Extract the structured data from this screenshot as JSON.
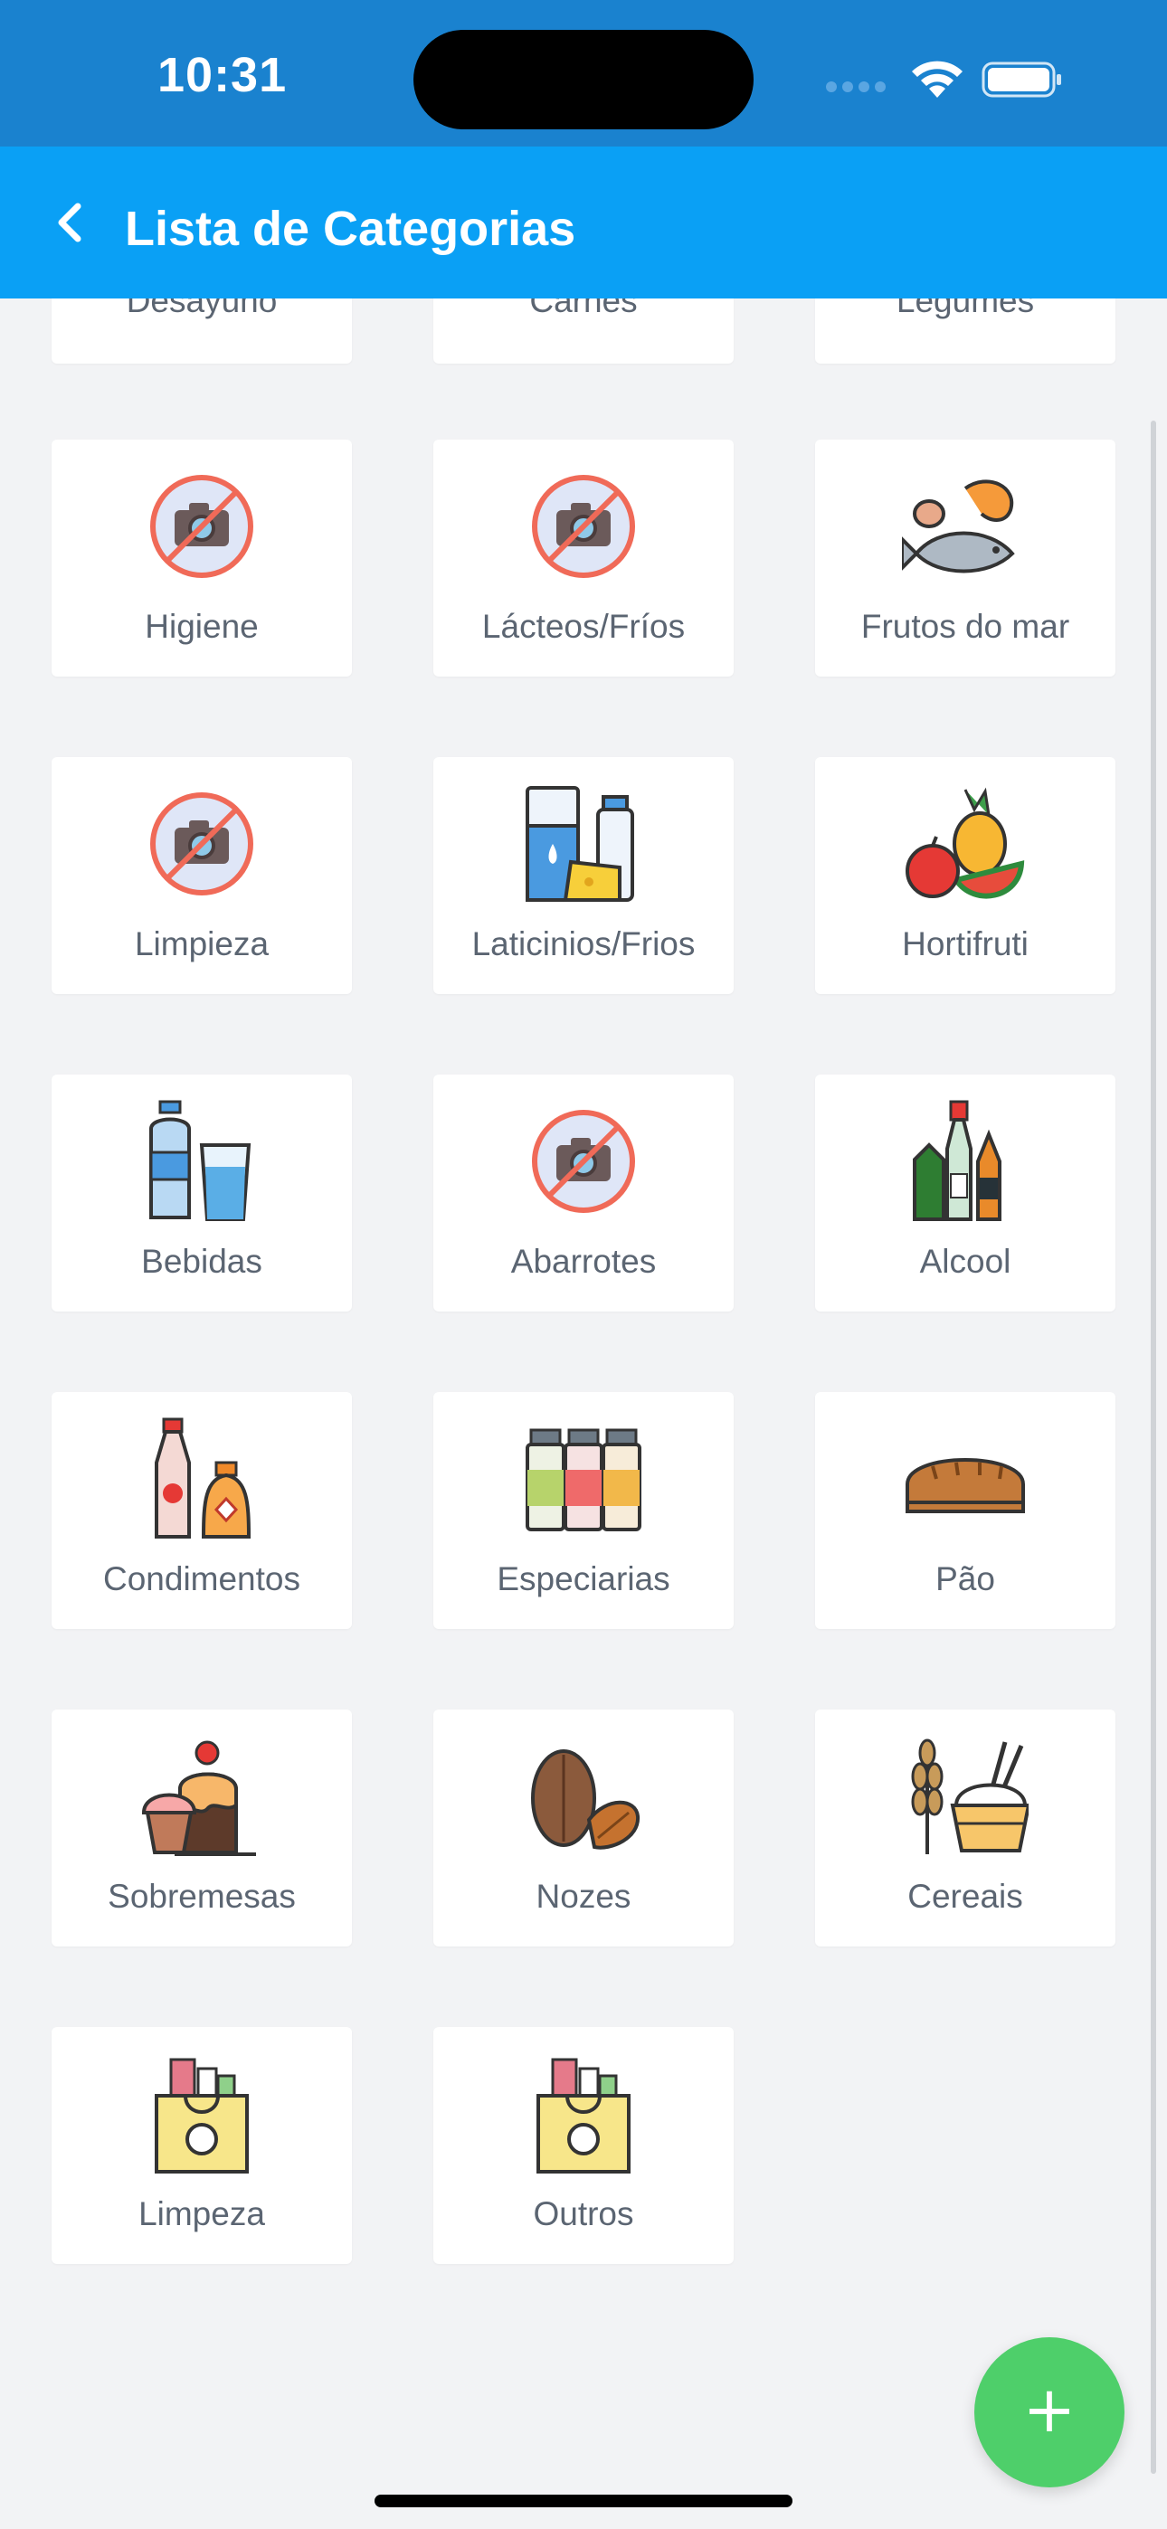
{
  "status_bar": {
    "time": "10:31"
  },
  "header": {
    "title": "Lista de Categorias",
    "background": "#0aa0f5"
  },
  "partial_row": [
    {
      "label": "Desayuno"
    },
    {
      "label": "Carnes"
    },
    {
      "label": "Legumes"
    }
  ],
  "categories": [
    {
      "label": "Higiene",
      "icon": "no-photo-icon"
    },
    {
      "label": "Lácteos/Fríos",
      "icon": "no-photo-icon"
    },
    {
      "label": "Frutos do mar",
      "icon": "seafood-icon"
    },
    {
      "label": "Limpieza",
      "icon": "no-photo-icon"
    },
    {
      "label": "Laticinios/Frios",
      "icon": "dairy-icon"
    },
    {
      "label": "Hortifruti",
      "icon": "fruits-icon"
    },
    {
      "label": "Bebidas",
      "icon": "water-bottle-icon"
    },
    {
      "label": "Abarrotes",
      "icon": "no-photo-icon"
    },
    {
      "label": "Alcool",
      "icon": "liquor-bottles-icon"
    },
    {
      "label": "Condimentos",
      "icon": "condiment-bottles-icon"
    },
    {
      "label": "Especiarias",
      "icon": "spice-jars-icon"
    },
    {
      "label": "Pão",
      "icon": "bread-icon"
    },
    {
      "label": "Sobremesas",
      "icon": "dessert-icon"
    },
    {
      "label": "Nozes",
      "icon": "nuts-icon"
    },
    {
      "label": "Cereais",
      "icon": "cereal-icon"
    },
    {
      "label": "Limpeza",
      "icon": "grocery-bag-icon"
    },
    {
      "label": "Outros",
      "icon": "grocery-bag-icon"
    }
  ],
  "fab": {
    "label": "+",
    "color": "#4ecf6a"
  }
}
